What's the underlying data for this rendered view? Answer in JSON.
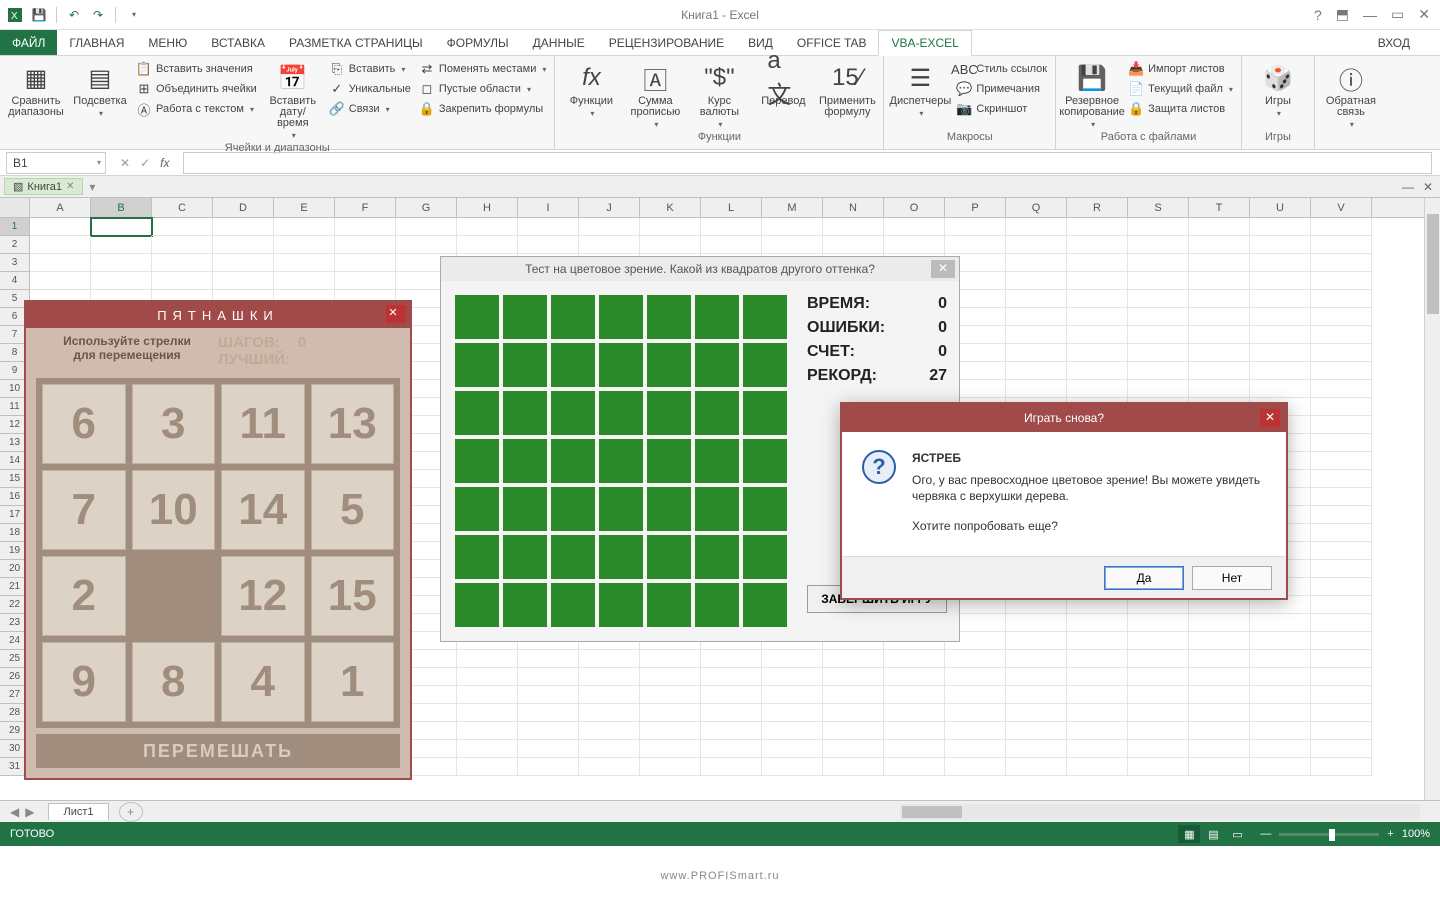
{
  "app": {
    "title": "Книга1 - Excel"
  },
  "tabs": {
    "file": "ФАЙЛ",
    "list": [
      "ГЛАВНАЯ",
      "Меню",
      "ВСТАВКА",
      "РАЗМЕТКА СТРАНИЦЫ",
      "ФОРМУЛЫ",
      "ДАННЫЕ",
      "РЕЦЕНЗИРОВАНИЕ",
      "ВИД",
      "OFFICE TAB",
      "VBA-Excel"
    ],
    "active": "VBA-Excel",
    "right": "Вход"
  },
  "ribbon": {
    "g1": {
      "label": "Ячейки и диапазоны",
      "big": [
        {
          "l1": "Сравнить",
          "l2": "диапазоны"
        },
        {
          "l1": "Подсветка"
        }
      ],
      "col": [
        "Вставить значения",
        "Объединить ячейки",
        "Работа с текстом"
      ]
    },
    "g2": {
      "big": [
        {
          "l1": "Вставить",
          "l2": "дату/время"
        }
      ],
      "col": [
        "Вставить",
        "Уникальные",
        "Связи"
      ]
    },
    "g3": {
      "col": [
        "Поменять местами",
        "Пустые области",
        "Закрепить формулы"
      ]
    },
    "g4": {
      "label": "Функции",
      "big": [
        {
          "l1": "Функции"
        },
        {
          "l1": "Сумма",
          "l2": "прописью"
        },
        {
          "l1": "Курс",
          "l2": "валюты"
        },
        {
          "l1": "Перевод"
        },
        {
          "l1": "Применить",
          "l2": "формулу"
        }
      ]
    },
    "g5": {
      "label": "Макросы",
      "big": [
        {
          "l1": "Диспетчеры"
        }
      ],
      "col": [
        "Стиль ссылок",
        "Примечания",
        "Скриншот"
      ]
    },
    "g6": {
      "label": "Работа с файлами",
      "big": [
        {
          "l1": "Резервное",
          "l2": "копирование"
        }
      ],
      "col": [
        "Импорт листов",
        "Текущий файл",
        "Защита листов"
      ]
    },
    "g7": {
      "label": "Игры",
      "big": [
        {
          "l1": "Игры"
        }
      ]
    },
    "g8": {
      "big": [
        {
          "l1": "Обратная",
          "l2": "связь"
        }
      ]
    }
  },
  "namebox": "B1",
  "filetab": "Книга1",
  "cols": [
    "A",
    "B",
    "C",
    "D",
    "E",
    "F",
    "G",
    "H",
    "I",
    "J",
    "K",
    "L",
    "M",
    "N",
    "O",
    "P",
    "Q",
    "R",
    "S",
    "T",
    "U",
    "V"
  ],
  "rows": 31,
  "wstab": "Лист1",
  "status": {
    "ready": "ГОТОВО",
    "zoom": "100%"
  },
  "pyat": {
    "title": "ПЯТНАШКИ",
    "hint1": "Используйте стрелки",
    "hint2": "для перемещения",
    "steps_l": "ШАГОВ:",
    "steps_v": "0",
    "best_l": "ЛУЧШИЙ:",
    "tiles": [
      "6",
      "3",
      "11",
      "13",
      "7",
      "10",
      "14",
      "5",
      "2",
      "",
      "12",
      "15",
      "9",
      "8",
      "4",
      "1"
    ],
    "shuffle": "ПЕРЕМЕШАТЬ"
  },
  "ct": {
    "title": "Тест на цветовое зрение. Какой из квадратов другого оттенка?",
    "time_l": "ВРЕМЯ:",
    "time_v": "0",
    "err_l": "ОШИБКИ:",
    "err_v": "0",
    "score_l": "СЧЕТ:",
    "score_v": "0",
    "rec_l": "РЕКОРД:",
    "rec_v": "27",
    "end": "ЗАВЕРШИТЬ ИГРУ",
    "grid_n": 49
  },
  "msg": {
    "title": "Играть снова?",
    "head": "ЯСТРЕБ",
    "body": "Ого, у вас превосходное цветовое зрение! Вы можете увидеть червяка с верхушки дерева.",
    "q": "Хотите попробовать еще?",
    "yes": "Да",
    "no": "Нет"
  },
  "watermark": "www.PROFISmart.ru"
}
